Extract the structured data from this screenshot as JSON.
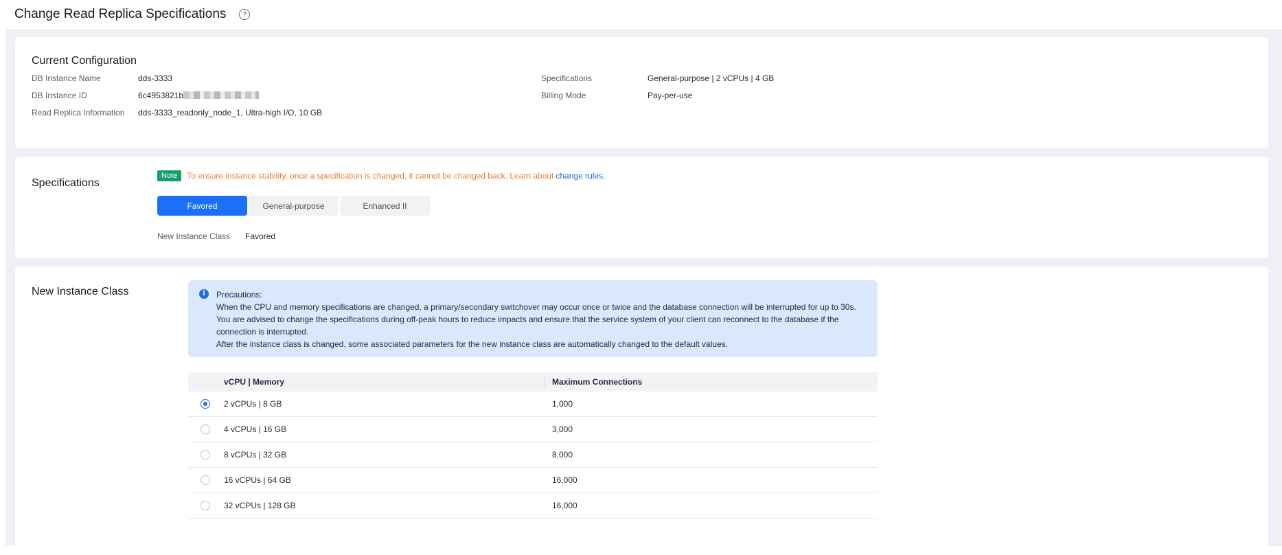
{
  "page": {
    "title": "Change Read Replica Specifications",
    "help_icon": "?"
  },
  "current_config": {
    "title": "Current Configuration",
    "left": [
      {
        "label": "DB Instance Name",
        "value": "dds-3333"
      },
      {
        "label": "DB Instance ID",
        "value": "6c4953821b"
      },
      {
        "label": "Read Replica Information",
        "value": "dds-3333_readonly_node_1, Ultra-high I/O, 10 GB"
      }
    ],
    "right": [
      {
        "label": "Specifications",
        "value": "General-purpose | 2 vCPUs | 4 GB"
      },
      {
        "label": "Billing Mode",
        "value": "Pay-per-use"
      }
    ]
  },
  "specifications": {
    "title": "Specifications",
    "note_badge": "Note",
    "note_text": "To ensure instance stability, once a specification is changed, it cannot be changed back. Learn about",
    "note_link": "change rules.",
    "tabs": [
      {
        "label": "Favored",
        "active": true
      },
      {
        "label": "General-purpose",
        "active": false
      },
      {
        "label": "Enhanced II",
        "active": false
      }
    ],
    "class_label": "New Instance Class",
    "class_value": "Favored"
  },
  "new_instance_class": {
    "title": "New Instance Class",
    "info_icon": "i",
    "precautions": [
      "Precautions:",
      "When the CPU and memory specifications are changed, a primary/secondary switchover may occur once or twice and the database connection will be interrupted for up to 30s.",
      "You are advised to change the specifications during off-peak hours to reduce impacts and ensure that the service system of your client can reconnect to the database if the",
      "connection is interrupted.",
      "After the instance class is changed, some associated parameters for the new instance class are automatically changed to the default values."
    ],
    "columns": [
      "vCPU | Memory",
      "Maximum Connections"
    ],
    "rows": [
      {
        "spec": "2 vCPUs | 8 GB",
        "max_conn": "1,000",
        "selected": true
      },
      {
        "spec": "4 vCPUs | 16 GB",
        "max_conn": "3,000",
        "selected": false
      },
      {
        "spec": "8 vCPUs | 32 GB",
        "max_conn": "8,000",
        "selected": false
      },
      {
        "spec": "16 vCPUs | 64 GB",
        "max_conn": "16,000",
        "selected": false
      },
      {
        "spec": "32 vCPUs | 128 GB",
        "max_conn": "16,000",
        "selected": false
      }
    ]
  },
  "colors": {
    "accent": "#1b6ff8",
    "note_green": "#14a06a",
    "warning_orange": "#ef7a25",
    "link_blue": "#1c67d6",
    "info_bg": "#d9e8fc"
  }
}
